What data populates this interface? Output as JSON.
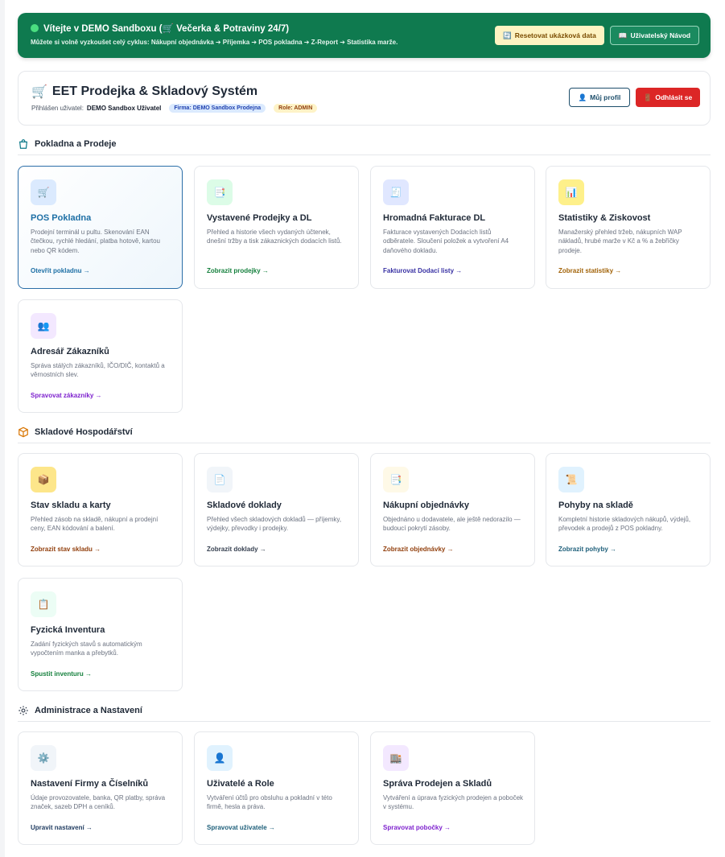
{
  "banner": {
    "title": "Vítejte v DEMO Sandboxu (🛒 Večerka & Potraviny 24/7)",
    "subtitle": "Můžete si volně vyzkoušet celý cyklus: Nákupní objednávka ➔ Příjemka ➔ POS pokladna ➔ Z-Report ➔ Statistika marže.",
    "reset_button": "Resetovat ukázková data",
    "guide_button": "Uživatelský Návod"
  },
  "header": {
    "app_title": "EET Prodejka & Skladový Systém",
    "logged_in_label": "Přihlášen uživatel:",
    "user_name": "DEMO Sandbox Uživatel",
    "firm_badge": "Firma: DEMO Sandbox Prodejna",
    "role_badge": "Role: ADMIN",
    "profile_button": "Můj profil",
    "logout_button": "Odhlásit se"
  },
  "sections": {
    "sales": {
      "title": "Pokladna a Prodeje",
      "cards": [
        {
          "title": "POS Pokladna",
          "desc": "Prodejní terminál u pultu. Skenování EAN čtečkou, rychlé hledání, platba hotově, kartou nebo QR kódem.",
          "link": "Otevřít pokladnu →",
          "icon": "cart-icon"
        },
        {
          "title": "Vystavené Prodejky a DL",
          "desc": "Přehled a historie všech vydaných účtenek, dnešní tržby a tisk zákaznických dodacích listů.",
          "link": "Zobrazit prodejky →",
          "icon": "receipt-icon"
        },
        {
          "title": "Hromadná Fakturace DL",
          "desc": "Fakturace vystavených Dodacích listů odběratele. Sloučení položek a vytvoření A4 daňového dokladu.",
          "link": "Fakturovat Dodací listy →",
          "icon": "invoice-icon"
        },
        {
          "title": "Statistiky & Ziskovost",
          "desc": "Manažerský přehled tržeb, nákupních WAP nákladů, hrubé marže v Kč a % a žebříčky prodeje.",
          "link": "Zobrazit statistiky →",
          "icon": "chart-icon"
        },
        {
          "title": "Adresář Zákazníků",
          "desc": "Správa stálých zákazníků, IČO/DIČ, kontaktů a věrnostních slev.",
          "link": "Spravovat zákazníky →",
          "icon": "people-icon"
        }
      ]
    },
    "warehouse": {
      "title": "Skladové Hospodářství",
      "cards": [
        {
          "title": "Stav skladu a karty",
          "desc": "Přehled zásob na skladě, nákupní a prodejní ceny, EAN kódování a balení.",
          "link": "Zobrazit stav skladu →",
          "icon": "package-icon"
        },
        {
          "title": "Skladové doklady",
          "desc": "Přehled všech skladových dokladů — příjemky, výdejky, převodky i prodejky.",
          "link": "Zobrazit doklady →",
          "icon": "document-icon"
        },
        {
          "title": "Nákupní objednávky",
          "desc": "Objednáno u dodavatele, ale ještě nedorazilo — budoucí pokrytí zásoby.",
          "link": "Zobrazit objednávky →",
          "icon": "order-icon"
        },
        {
          "title": "Pohyby na skladě",
          "desc": "Kompletní historie skladových nákupů, výdejů, převodek a prodejů z POS pokladny.",
          "link": "Zobrazit pohyby →",
          "icon": "scroll-icon"
        },
        {
          "title": "Fyzická Inventura",
          "desc": "Zadání fyzických stavů s automatickým vypočtením manka a přebytků.",
          "link": "Spustit inventuru →",
          "icon": "clipboard-icon"
        }
      ]
    },
    "admin": {
      "title": "Administrace a Nastavení",
      "cards": [
        {
          "title": "Nastavení Firmy a Číselníků",
          "desc": "Údaje provozovatele, banka, QR platby, správa značek, sazeb DPH a ceníků.",
          "link": "Upravit nastavení →",
          "icon": "gear-icon"
        },
        {
          "title": "Uživatelé a Role",
          "desc": "Vytváření účtů pro obsluhu a pokladní v této firmě, hesla a práva.",
          "link": "Spravovat uživatele →",
          "icon": "user-icon"
        },
        {
          "title": "Správa Prodejen a Skladů",
          "desc": "Vytváření a úprava fyzických prodejen a poboček v systému.",
          "link": "Spravovat pobočky →",
          "icon": "building-icon"
        }
      ]
    }
  }
}
